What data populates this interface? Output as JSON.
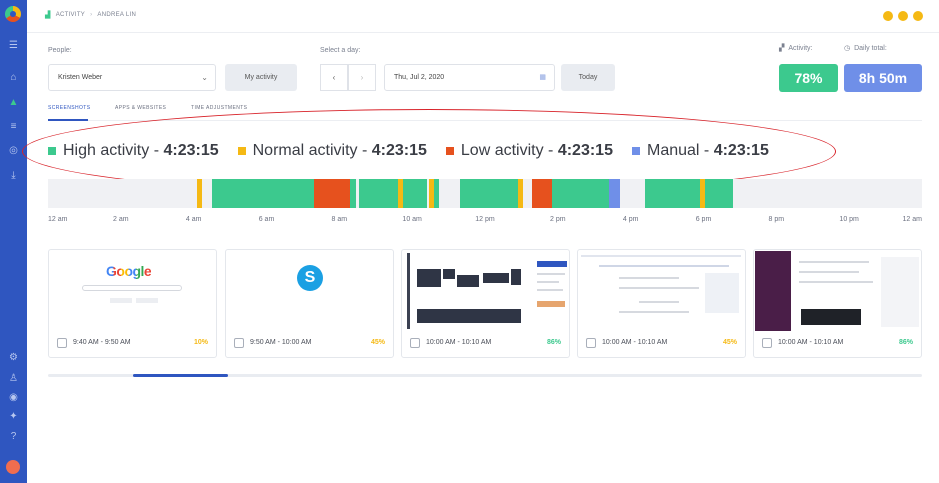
{
  "breadcrumb": {
    "section": "ACTIVITY",
    "person": "ANDREA LIN"
  },
  "filters": {
    "people_label": "People:",
    "person_value": "Kristen Weber",
    "my_activity": "My activity",
    "day_label": "Select a day:",
    "date_value": "Thu, Jul 2, 2020",
    "today": "Today"
  },
  "stats": {
    "activity_label": "Activity:",
    "activity_value": "78%",
    "daily_label": "Daily total:",
    "daily_value": "8h 50m"
  },
  "tabs": [
    {
      "label": "SCREENSHOTS"
    },
    {
      "label": "APPS & WEBSITES"
    },
    {
      "label": "TIME ADJUSTMENTS"
    }
  ],
  "legend": [
    {
      "name": "High activity",
      "time": "4:23:15",
      "color": "#3cc98e"
    },
    {
      "name": "Normal activity",
      "time": "4:23:15",
      "color": "#f5b914"
    },
    {
      "name": "Low activity",
      "time": "4:23:15",
      "color": "#e6511e"
    },
    {
      "name": "Manual",
      "time": "4:23:15",
      "color": "#6f8fe8"
    }
  ],
  "timeline_hours": [
    "12 am",
    "2 am",
    "4 am",
    "6 am",
    "8 am",
    "10 am",
    "12 pm",
    "2 pm",
    "4 pm",
    "6 pm",
    "8 pm",
    "10 pm",
    "12 am"
  ],
  "timeline_segments": [
    {
      "start_hour": 4.1,
      "end_hour": 4.22,
      "kind": "normal"
    },
    {
      "start_hour": 4.5,
      "end_hour": 7.3,
      "kind": "high"
    },
    {
      "start_hour": 7.3,
      "end_hour": 8.3,
      "kind": "low"
    },
    {
      "start_hour": 8.3,
      "end_hour": 8.45,
      "kind": "high"
    },
    {
      "start_hour": 8.55,
      "end_hour": 9.6,
      "kind": "high"
    },
    {
      "start_hour": 9.6,
      "end_hour": 9.75,
      "kind": "normal"
    },
    {
      "start_hour": 9.75,
      "end_hour": 10.4,
      "kind": "high"
    },
    {
      "start_hour": 10.45,
      "end_hour": 10.6,
      "kind": "normal"
    },
    {
      "start_hour": 10.6,
      "end_hour": 10.75,
      "kind": "high"
    },
    {
      "start_hour": 11.3,
      "end_hour": 12.9,
      "kind": "high"
    },
    {
      "start_hour": 12.9,
      "end_hour": 13.05,
      "kind": "normal"
    },
    {
      "start_hour": 13.3,
      "end_hour": 13.85,
      "kind": "low"
    },
    {
      "start_hour": 13.85,
      "end_hour": 15.4,
      "kind": "high"
    },
    {
      "start_hour": 15.4,
      "end_hour": 15.7,
      "kind": "manual"
    },
    {
      "start_hour": 16.4,
      "end_hour": 17.9,
      "kind": "high"
    },
    {
      "start_hour": 17.9,
      "end_hour": 18.05,
      "kind": "normal"
    },
    {
      "start_hour": 18.05,
      "end_hour": 18.8,
      "kind": "high"
    }
  ],
  "screenshots": [
    {
      "time": "9:40 AM - 9:50 AM",
      "percent": "10%",
      "percent_color": "#f5b914",
      "kind": "google"
    },
    {
      "time": "9:50 AM - 10:00 AM",
      "percent": "45%",
      "percent_color": "#f5b914",
      "kind": "skype"
    },
    {
      "time": "10:00 AM - 10:10 AM",
      "percent": "86%",
      "percent_color": "#3cc98e",
      "kind": "dashboard"
    },
    {
      "time": "10:00 AM - 10:10 AM",
      "percent": "45%",
      "percent_color": "#f5b914",
      "kind": "sheet"
    },
    {
      "time": "10:00 AM - 10:10 AM",
      "percent": "86%",
      "percent_color": "#3cc98e",
      "kind": "slack"
    }
  ],
  "google_logo": "Google",
  "skype_letter": "S",
  "colors": {
    "primary": "#2f56c0",
    "high": "#3cc98e",
    "normal": "#f5b914",
    "low": "#e6511e",
    "manual": "#6f8fe8",
    "highlight": "#d8232a"
  }
}
